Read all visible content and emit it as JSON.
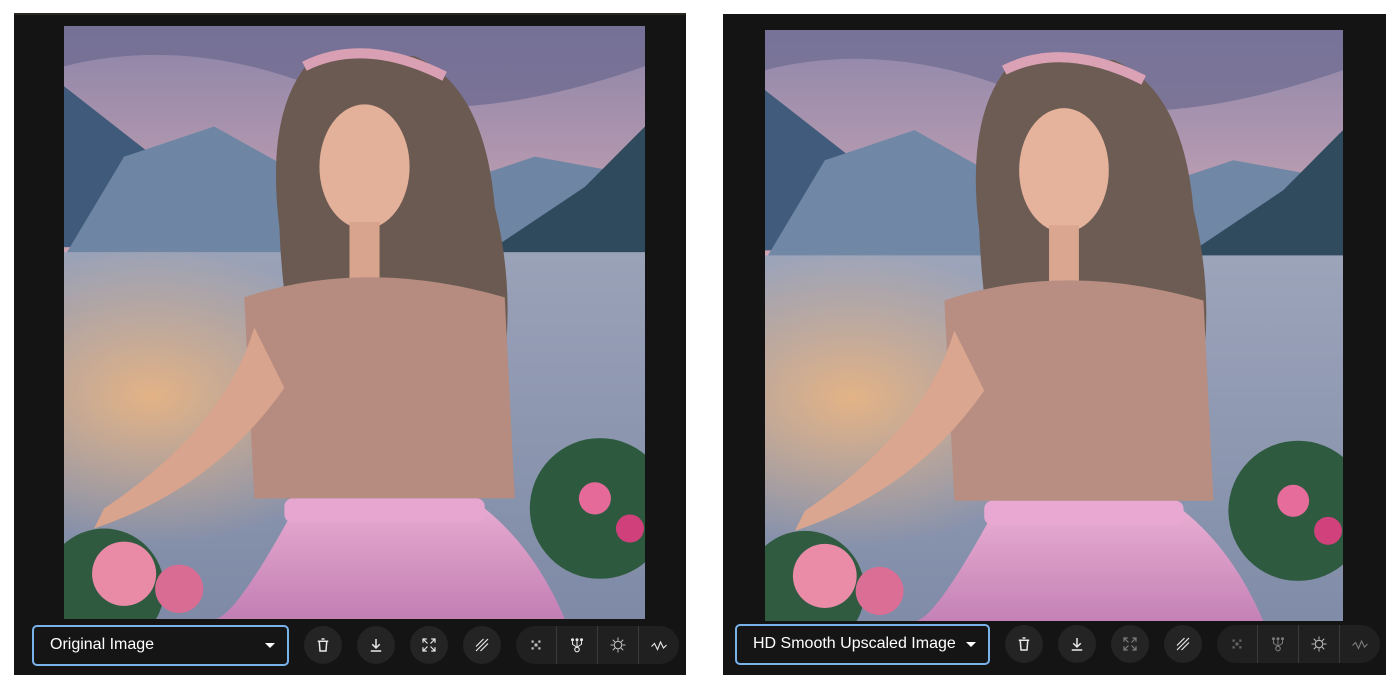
{
  "left_panel": {
    "select_label": "Original Image",
    "image_alt_icon": "portrait-photo"
  },
  "right_panel": {
    "select_label": "HD Smooth Upscaled Image",
    "image_alt_icon": "portrait-photo"
  },
  "toolbar_icons": [
    "trash-icon",
    "download-icon",
    "expand-icon",
    "hatch-icon",
    "grid-icon",
    "tree-icon",
    "sun-icon",
    "wave-icon"
  ],
  "colors": {
    "panel_bg": "#141414",
    "select_border": "#7ab2ea",
    "button_bg": "#242424",
    "text": "#ffffff"
  }
}
